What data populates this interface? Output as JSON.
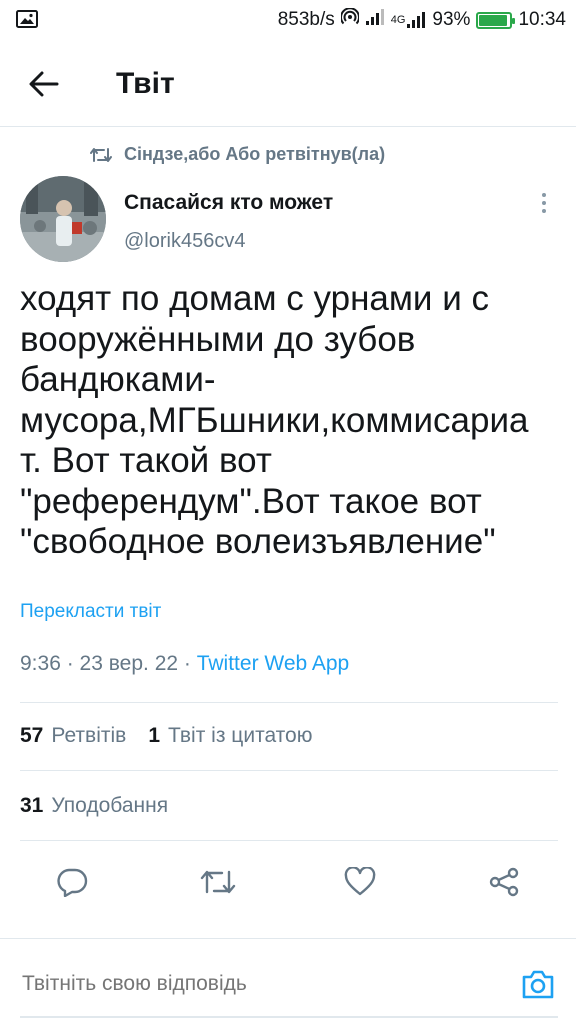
{
  "status_bar": {
    "network_speed": "853b/s",
    "network_type": "4G",
    "battery_percent": "93%",
    "battery_level": 0.93,
    "time": "10:34",
    "icons": [
      "image-icon",
      "hotspot-icon",
      "signal-icon",
      "signal-4g-icon",
      "battery-icon"
    ]
  },
  "header": {
    "title": "Твіт",
    "back_icon": "arrow-left-icon"
  },
  "tweet": {
    "retweet_context": "Сіндзе,або Або ретвітнув(ла)",
    "author_name": "Спасайся кто может",
    "author_handle": "@lorik456cv4",
    "text": "ходят по домам с урнами и с\nвооружёнными до зубов\nбандюками-\nмусора,МГБшники,коммисариа\nт. Вот такой вот\n\"референдум\".Вот такое вот\n\"свободное волеизъявление\"",
    "translate_label": "Перекласти твіт",
    "time": "9:36",
    "date": "23 вер. 22",
    "source_app": "Twitter Web App",
    "separator": " · "
  },
  "stats": {
    "retweets_count": "57",
    "retweets_label": "Ретвітів",
    "quotes_count": "1",
    "quotes_label": "Твіт із цитатою",
    "likes_count": "31",
    "likes_label": "Уподобання"
  },
  "actions": [
    "reply-icon",
    "retweet-icon",
    "like-icon",
    "share-icon"
  ],
  "reply": {
    "placeholder": "Твітніть свою відповідь",
    "camera_icon": "camera-icon"
  },
  "colors": {
    "accent": "#1da1f2",
    "secondary_text": "#657786",
    "primary_text": "#14171a",
    "battery": "#2aa84a",
    "divider": "#e1e8ed"
  }
}
